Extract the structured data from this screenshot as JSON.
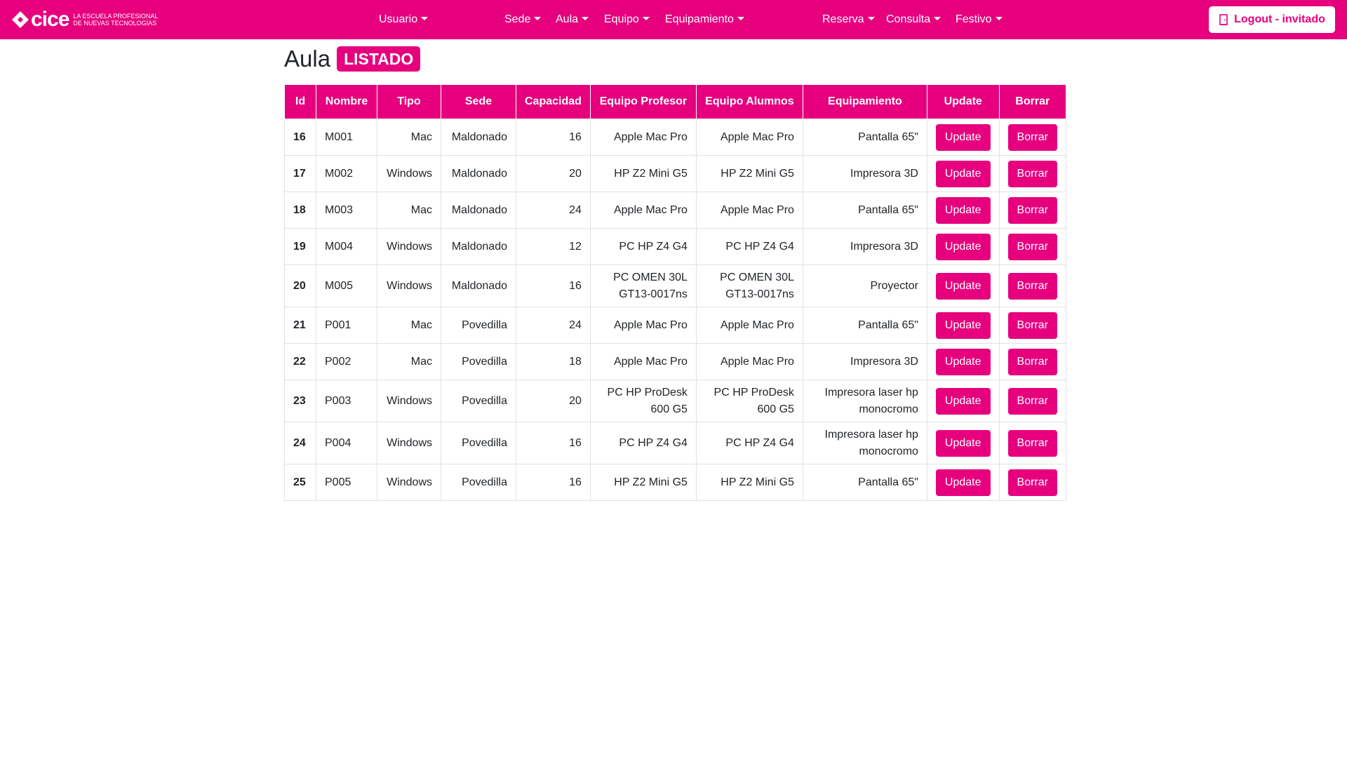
{
  "brand": {
    "logo_text": "cice",
    "tagline_line1": "LA ESCUELA PROFESIONAL",
    "tagline_line2": "DE NUEVAS TECNOLOGÍAS",
    "color": "#e6007e"
  },
  "nav": {
    "items": [
      {
        "label": "Usuario"
      },
      {
        "label": "Sede"
      },
      {
        "label": "Aula"
      },
      {
        "label": "Equipo"
      },
      {
        "label": "Equipamiento"
      },
      {
        "label": "Reserva"
      },
      {
        "label": "Consulta"
      },
      {
        "label": "Festivo"
      }
    ],
    "logout_label": "Logout - invitado",
    "logout_icon": "door-icon"
  },
  "page": {
    "title": "Aula",
    "badge": "LISTADO"
  },
  "table": {
    "headers": [
      "Id",
      "Nombre",
      "Tipo",
      "Sede",
      "Capacidad",
      "Equipo Profesor",
      "Equipo Alumnos",
      "Equipamiento",
      "Update",
      "Borrar"
    ],
    "update_label": "Update",
    "borrar_label": "Borrar",
    "rows": [
      {
        "id": "16",
        "nombre": "M001",
        "tipo": "Mac",
        "sede": "Maldonado",
        "capacidad": "16",
        "equipo_profesor": "Apple Mac Pro",
        "equipo_alumnos": "Apple Mac Pro",
        "equipamiento": "Pantalla 65\""
      },
      {
        "id": "17",
        "nombre": "M002",
        "tipo": "Windows",
        "sede": "Maldonado",
        "capacidad": "20",
        "equipo_profesor": "HP Z2 Mini G5",
        "equipo_alumnos": "HP Z2 Mini G5",
        "equipamiento": "Impresora 3D"
      },
      {
        "id": "18",
        "nombre": "M003",
        "tipo": "Mac",
        "sede": "Maldonado",
        "capacidad": "24",
        "equipo_profesor": "Apple Mac Pro",
        "equipo_alumnos": "Apple Mac Pro",
        "equipamiento": "Pantalla 65\""
      },
      {
        "id": "19",
        "nombre": "M004",
        "tipo": "Windows",
        "sede": "Maldonado",
        "capacidad": "12",
        "equipo_profesor": "PC HP Z4 G4",
        "equipo_alumnos": "PC HP Z4 G4",
        "equipamiento": "Impresora 3D"
      },
      {
        "id": "20",
        "nombre": "M005",
        "tipo": "Windows",
        "sede": "Maldonado",
        "capacidad": "16",
        "equipo_profesor": "PC OMEN 30L GT13-0017ns",
        "equipo_alumnos": "PC OMEN 30L GT13-0017ns",
        "equipamiento": "Proyector"
      },
      {
        "id": "21",
        "nombre": "P001",
        "tipo": "Mac",
        "sede": "Povedilla",
        "capacidad": "24",
        "equipo_profesor": "Apple Mac Pro",
        "equipo_alumnos": "Apple Mac Pro",
        "equipamiento": "Pantalla 65\""
      },
      {
        "id": "22",
        "nombre": "P002",
        "tipo": "Mac",
        "sede": "Povedilla",
        "capacidad": "18",
        "equipo_profesor": "Apple Mac Pro",
        "equipo_alumnos": "Apple Mac Pro",
        "equipamiento": "Impresora 3D"
      },
      {
        "id": "23",
        "nombre": "P003",
        "tipo": "Windows",
        "sede": "Povedilla",
        "capacidad": "20",
        "equipo_profesor": "PC HP ProDesk 600 G5",
        "equipo_alumnos": "PC HP ProDesk 600 G5",
        "equipamiento": "Impresora laser hp monocromo"
      },
      {
        "id": "24",
        "nombre": "P004",
        "tipo": "Windows",
        "sede": "Povedilla",
        "capacidad": "16",
        "equipo_profesor": "PC HP Z4 G4",
        "equipo_alumnos": "PC HP Z4 G4",
        "equipamiento": "Impresora laser hp monocromo"
      },
      {
        "id": "25",
        "nombre": "P005",
        "tipo": "Windows",
        "sede": "Povedilla",
        "capacidad": "16",
        "equipo_profesor": "HP Z2 Mini G5",
        "equipo_alumnos": "HP Z2 Mini G5",
        "equipamiento": "Pantalla 65\""
      }
    ]
  }
}
